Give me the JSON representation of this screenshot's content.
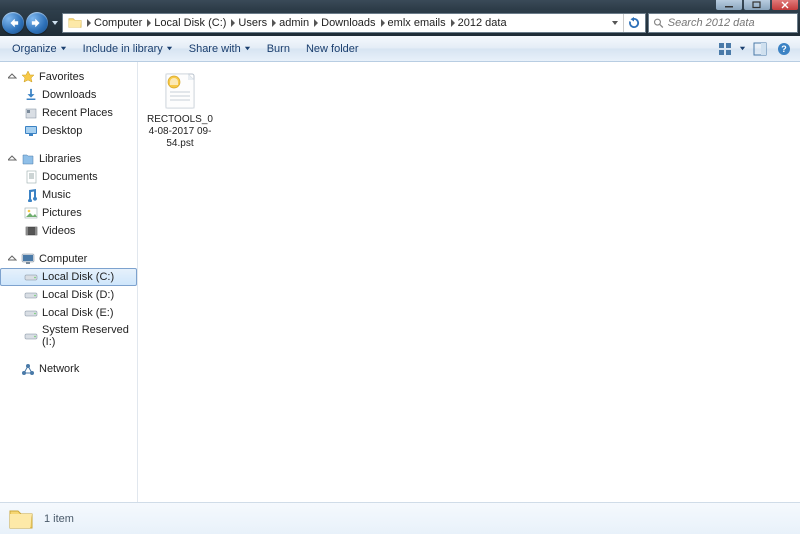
{
  "window": {
    "minimize": "–",
    "maximize": "☐",
    "close": "✕"
  },
  "breadcrumb": {
    "items": [
      "Computer",
      "Local Disk (C:)",
      "Users",
      "admin",
      "Downloads",
      "emlx emails",
      "2012 data"
    ]
  },
  "search": {
    "placeholder": "Search 2012 data"
  },
  "toolbar": {
    "organize": "Organize",
    "include": "Include in library",
    "share": "Share with",
    "burn": "Burn",
    "newfolder": "New folder"
  },
  "sidebar": {
    "favorites": {
      "label": "Favorites",
      "items": [
        {
          "label": "Downloads",
          "icon": "download-icon"
        },
        {
          "label": "Recent Places",
          "icon": "recent-icon"
        },
        {
          "label": "Desktop",
          "icon": "desktop-icon"
        }
      ]
    },
    "libraries": {
      "label": "Libraries",
      "items": [
        {
          "label": "Documents",
          "icon": "documents-icon"
        },
        {
          "label": "Music",
          "icon": "music-icon"
        },
        {
          "label": "Pictures",
          "icon": "pictures-icon"
        },
        {
          "label": "Videos",
          "icon": "videos-icon"
        }
      ]
    },
    "computer": {
      "label": "Computer",
      "items": [
        {
          "label": "Local Disk (C:)",
          "icon": "drive-icon",
          "selected": true
        },
        {
          "label": "Local Disk (D:)",
          "icon": "drive-icon"
        },
        {
          "label": "Local Disk (E:)",
          "icon": "drive-icon"
        },
        {
          "label": "System Reserved (I:)",
          "icon": "drive-icon"
        }
      ]
    },
    "network": {
      "label": "Network"
    }
  },
  "files": [
    {
      "name": "RECTOOLS_04-08-2017 09-54.pst"
    }
  ],
  "status": {
    "count": "1 item"
  }
}
